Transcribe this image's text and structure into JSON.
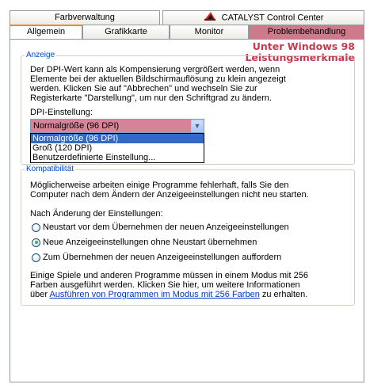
{
  "tabs_top": [
    {
      "label": "Farbverwaltung"
    },
    {
      "label": "CATALYST Control Center",
      "icon": "catalyst-logo-icon"
    }
  ],
  "tabs_bottom": [
    {
      "label": "Allgemein",
      "active": true
    },
    {
      "label": "Grafikkarte"
    },
    {
      "label": "Monitor"
    },
    {
      "label": "Problembehandlung",
      "highlight": true
    }
  ],
  "annotation": {
    "line1": "Unter Windows 98",
    "line2": "Leistungsmerkmale",
    "color": "#c8384e"
  },
  "display_group": {
    "legend": "Anzeige",
    "description_lines": [
      "Der DPI-Wert kann als Kompensierung vergrößert werden, wenn",
      "Elemente bei der aktuellen Bildschirmauflösung zu klein angezeigt",
      "werden. Klicken Sie auf \"Abbrechen\" und wechseln Sie zur",
      "Registerkarte \"Darstellung\", um nur den Schriftgrad zu ändern."
    ],
    "dpi_label": "DPI-Einstellung:",
    "dpi_selected": "Normalgröße (96 DPI)",
    "dpi_options": [
      "Normalgröße (96 DPI)",
      "Groß (120 DPI)",
      "Benutzerdefinierte Einstellung..."
    ]
  },
  "compat_group": {
    "legend": "Kompatibilität",
    "description_lines": [
      "Möglicherweise arbeiten einige Programme fehlerhaft, falls Sie den",
      "Computer nach dem Ändern der Anzeigeeinstellungen nicht neu starten."
    ],
    "after_change_label": "Nach Änderung der Einstellungen:",
    "radios": [
      {
        "label": "Neustart vor dem Übernehmen der neuen Anzeigeeinstellungen",
        "checked": false
      },
      {
        "label": "Neue Anzeigeeinstellungen ohne Neustart übernehmen",
        "checked": true
      },
      {
        "label": "Zum Übernehmen der neuen Anzeigeeinstellungen auffordern",
        "checked": false
      }
    ],
    "info_line1": "Einige Spiele und anderen Programme müssen in einem Modus mit 256",
    "info_line2": "Farben ausgeführt werden. Klicken Sie hier, um weitere Informationen",
    "info_line3_prefix": "über ",
    "info_link": "Ausführen von Programmen im Modus mit 256 Farben",
    "info_line3_suffix": " zu erhalten."
  },
  "colors": {
    "legend_blue": "#0046d5",
    "highlight_pink": "#cf7a8a",
    "selection_blue": "#316ac5"
  }
}
